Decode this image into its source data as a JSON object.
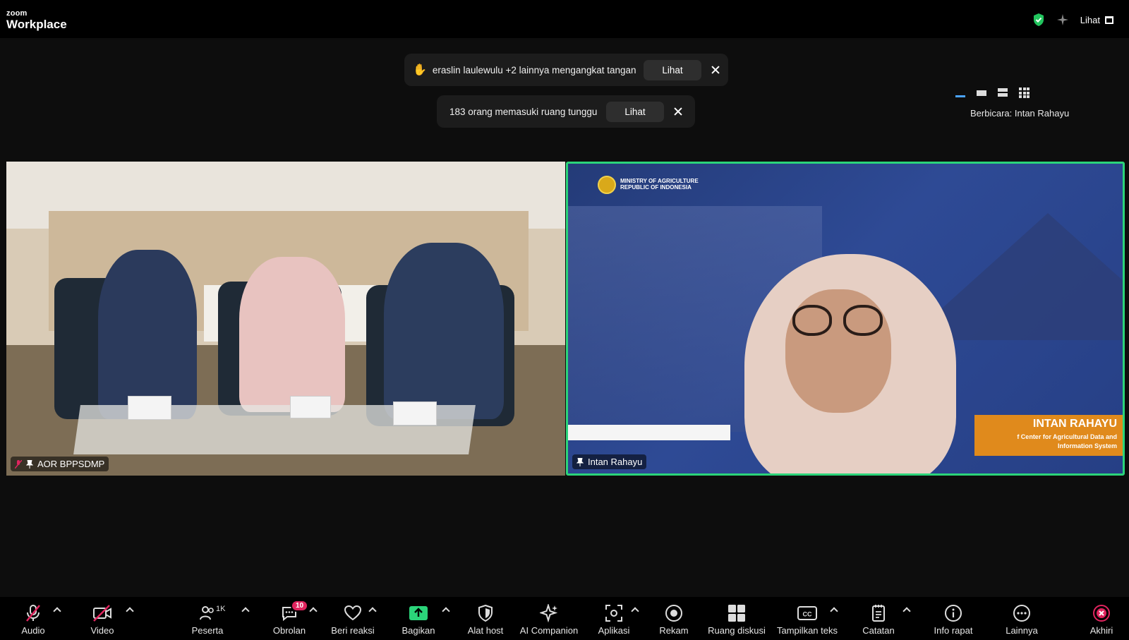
{
  "app": {
    "brand_small": "zoom",
    "brand_big": "Workplace"
  },
  "top": {
    "view_label": "Lihat"
  },
  "notifications": [
    {
      "icon": "raised-hand-icon",
      "text": "eraslin laulewulu +2 lainnya mengangkat tangan",
      "action": "Lihat"
    },
    {
      "text": "183 orang memasuki ruang tunggu",
      "action": "Lihat"
    }
  ],
  "speaker_line": "Berbicara: Intan Rahayu",
  "tiles": [
    {
      "name": "AOR BPPSDMP",
      "muted": true
    },
    {
      "name": "Intan Rahayu",
      "active": true,
      "overlay": {
        "ministry_line1": "MINISTRY OF AGRICULTURE",
        "ministry_line2": "REPUBLIC OF INDONESIA",
        "lower_third_name": "INTAN RAHAYU",
        "lower_third_role_1": "f Center for Agricultural Data and",
        "lower_third_role_2": "Information System"
      }
    }
  ],
  "toolbar": {
    "audio": "Audio",
    "video": "Video",
    "participants": "Peserta",
    "participants_count": "1K",
    "chat": "Obrolan",
    "chat_badge": "10",
    "reactions": "Beri reaksi",
    "share": "Bagikan",
    "host_tools": "Alat host",
    "ai_companion": "AI Companion",
    "apps": "Aplikasi",
    "record": "Rekam",
    "breakout": "Ruang diskusi",
    "captions": "Tampilkan teks",
    "notes": "Catatan",
    "meeting_info": "Info rapat",
    "more": "Lainnya",
    "end": "Akhiri"
  },
  "colors": {
    "active_border": "#2bd47a",
    "share_green": "#2bd47a",
    "end_red": "#e0245e",
    "shield_green": "#22c55e"
  }
}
